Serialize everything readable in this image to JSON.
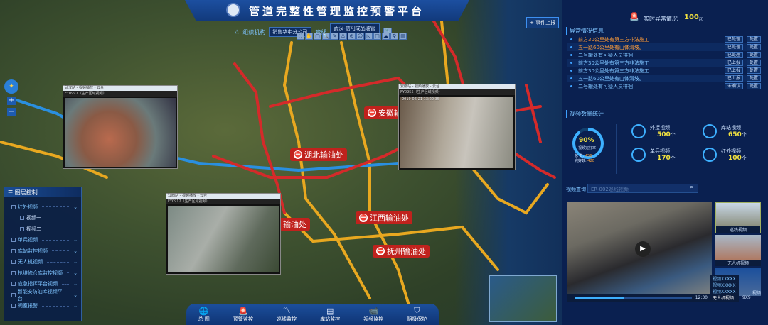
{
  "header": {
    "title": "管道完整性管理监控预警平台",
    "org_label": "组织机构",
    "org_value": "销售华中分公司",
    "pipeline_label": "管线",
    "pipeline_value": "武汉-信阳成品油管道",
    "report_button": "+ 事件上报"
  },
  "toolbar": [
    "⛶",
    "✋",
    "▢",
    "🔍",
    "✎",
    "⚓",
    "⊘",
    "☺",
    "◺",
    "□",
    "☁",
    "⚲",
    "▥"
  ],
  "map": {
    "labels": [
      "湖北输油处",
      "安徽输",
      "江西输油处",
      "抚州输油处",
      "输油处"
    ],
    "colors": {
      "pipeline_red": "#d42a2a",
      "pipeline_yellow": "#e8a820",
      "pipeline_blue": "#2a8fe0"
    }
  },
  "video_windows": [
    {
      "title": "武汉站 - 视频播放 - 云台",
      "sub": "FY0997（生产区域视频）"
    },
    {
      "title": "安徽站 - 视频播放 - 云台",
      "sub": "FY0955（生产区域视频）"
    },
    {
      "title": "江西站 - 视频播放 - 云台",
      "sub": "FY0912（生产区域视频）",
      "timestamp": "2019-06-21 13:22:35"
    }
  ],
  "layer_panel": {
    "title": "图层控制",
    "items": [
      {
        "label": "红外视频",
        "expand": true
      },
      {
        "label": "视频一",
        "sub": true
      },
      {
        "label": "视频二",
        "sub": true
      },
      {
        "label": "单兵视频",
        "expand": true
      },
      {
        "label": "库站监控视频",
        "expand": true
      },
      {
        "label": "无人机视频",
        "expand": true
      },
      {
        "label": "抢维修仓库监控视频",
        "expand": true
      },
      {
        "label": "应急指挥平台视频",
        "expand": true
      },
      {
        "label": "智能安防油库视频平台",
        "expand": true
      },
      {
        "label": "阀室报警",
        "expand": true
      }
    ]
  },
  "nav": [
    {
      "label": "总 图",
      "icon": "globe"
    },
    {
      "label": "预警监控",
      "icon": "alarm"
    },
    {
      "label": "巡线监控",
      "icon": "route"
    },
    {
      "label": "库站监控",
      "icon": "warehouse"
    },
    {
      "label": "视频监控",
      "icon": "camera",
      "active": true
    },
    {
      "label": "阴极保护",
      "icon": "shield"
    }
  ],
  "realtime": {
    "label": "实时异常情况",
    "count": "100",
    "unit": "起"
  },
  "alarms": {
    "title": "异常情况信息",
    "rows": [
      {
        "text": "前方30公里处有第三方非法施工",
        "status": "已处理",
        "action": "处置",
        "hot": true
      },
      {
        "text": "五一路60公里处有山体滑坡。",
        "status": "已处理",
        "action": "处置",
        "hot": true
      },
      {
        "text": "二号罐处有可疑人员徘徊",
        "status": "已处理",
        "action": "处置"
      },
      {
        "text": "前方30公里处有第三方非法施工",
        "status": "已上报",
        "action": "处置"
      },
      {
        "text": "前方30公里处有第三方非法施工",
        "status": "已上报",
        "action": "处置"
      },
      {
        "text": "五一路60公里处有山体滑坡。",
        "status": "已上报",
        "action": "处置"
      },
      {
        "text": "二号罐处有可疑人员徘徊",
        "status": "未确认",
        "action": "处置"
      }
    ]
  },
  "video_stats": {
    "title": "视频数量统计",
    "rate": "90%",
    "rate_label": "视频完好率",
    "total_label": "总 数:",
    "total": "456",
    "good_label": "完好数:",
    "good": "420",
    "rate_value": 0.9,
    "items": [
      {
        "label": "外接视频",
        "value": "500",
        "unit": "个"
      },
      {
        "label": "库站视频",
        "value": "650",
        "unit": "个"
      },
      {
        "label": "单兵视频",
        "value": "170",
        "unit": "个"
      },
      {
        "label": "红外视频",
        "value": "100",
        "unit": "个"
      }
    ]
  },
  "video_query": {
    "label": "视频查询",
    "placeholder": "ER-002巡线视频"
  },
  "player": {
    "time": "12:30",
    "progress": 0.42,
    "thumbs": [
      "巡线视频",
      "无人机视频",
      "视频"
    ],
    "list": [
      "视频XXXXX",
      "视频XXXXX",
      "视频XXXXX"
    ],
    "select1": "无人机视频",
    "select2": "9X9"
  }
}
